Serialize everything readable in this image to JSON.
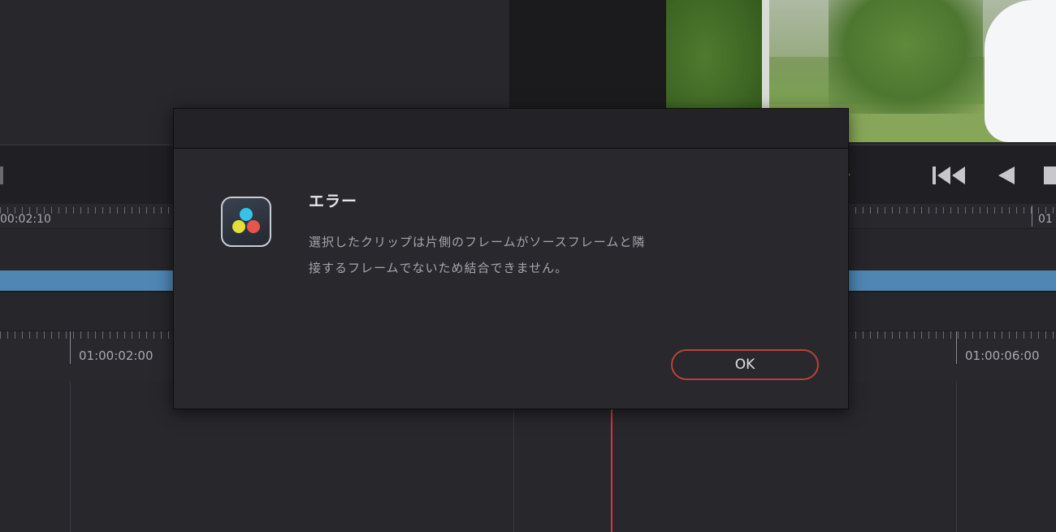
{
  "dialog": {
    "title": "エラー",
    "message": "選択したクリップは片側のフレームがソースフレームと隣接するフレームでないため結合できません。",
    "ok_label": "OK",
    "app_icon": "davinci-resolve-icon"
  },
  "timeline": {
    "top_ruler_left_label": "00:02:10",
    "top_ruler_right_label": "01",
    "bottom_ruler_labels": [
      "01:00:02:00",
      "01:00:06:00"
    ]
  },
  "transport": {
    "icons": [
      "next-icon",
      "skip-to-start-icon",
      "play-reverse-icon",
      "stop-icon"
    ]
  },
  "colors": {
    "accent_button_border": "#b8423a",
    "clip": "#4e86b4",
    "playhead": "#d03a30"
  }
}
